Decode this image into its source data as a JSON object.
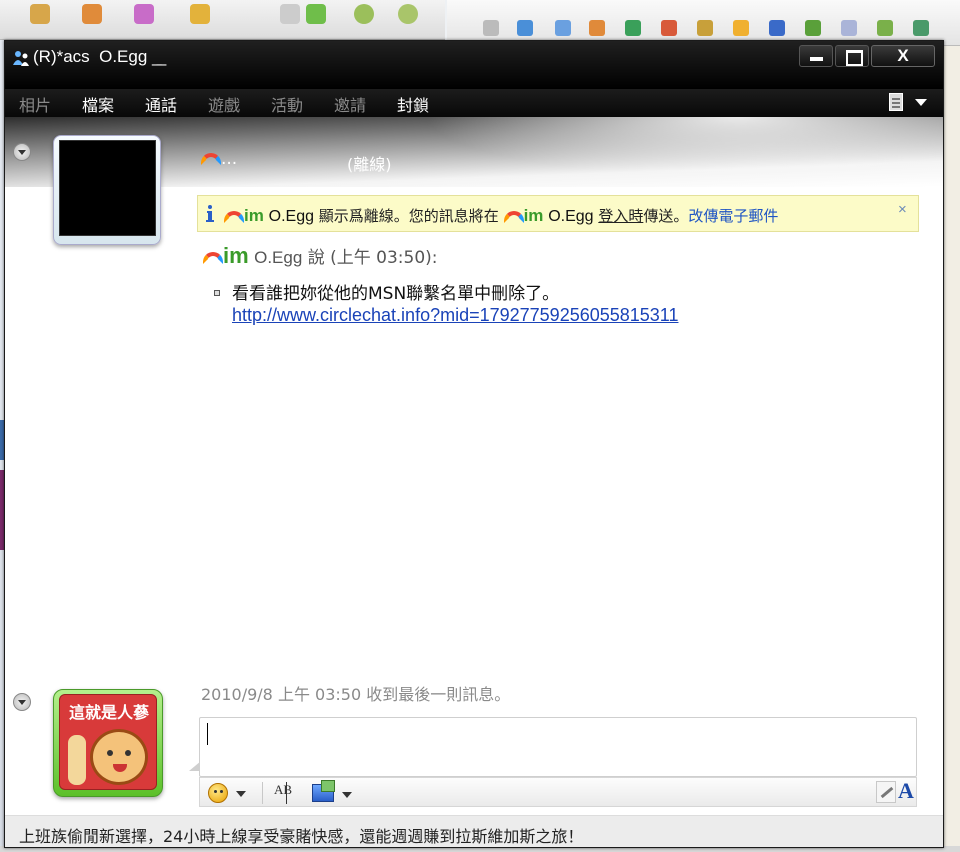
{
  "window": {
    "title": "(R)*acs  O.Egg  ̲ ̲"
  },
  "menu": {
    "items": [
      {
        "label": "相片",
        "enabled": false
      },
      {
        "label": "檔案",
        "enabled": true
      },
      {
        "label": "通話",
        "enabled": true
      },
      {
        "label": "遊戲",
        "enabled": false
      },
      {
        "label": "活動",
        "enabled": false
      },
      {
        "label": "邀請",
        "enabled": false
      },
      {
        "label": "封鎖",
        "enabled": true
      }
    ]
  },
  "contact": {
    "name": "...",
    "status": "(離線)"
  },
  "notice": {
    "nick": "O.Egg",
    "text_before": "顯示爲離線。您的訊息將在",
    "nick2": "O.Egg",
    "underline_text": "登入時",
    "text_after": "傳送。",
    "link": "改傳電子郵件",
    "close": "×",
    "im_logo": "im"
  },
  "message": {
    "im_logo": "im",
    "sender": "O.Egg",
    "says": "說 (上午 03:50):",
    "text": "看看誰把妳從他的MSN聯繫名單中刪除了。",
    "link": "http://www.circlechat.info?mid=17927759256055815311"
  },
  "footer": {
    "last_message": "2010/9/8 上午 03:50 收到最後一則訊息。",
    "my_picture_caption": "這就是人蔘",
    "font_button": "A",
    "voice_clip_label": "AB"
  },
  "ad": {
    "text": "上班族偷閒新選擇，24小時上線享受豪賭快感，還能週週賺到拉斯維加斯之旅！"
  },
  "colors": {
    "accent_link": "#1a43b8",
    "im_green": "#3a9b2a",
    "notice_bg": "#fcfbc8",
    "titlebar": "#000000"
  },
  "icons": {
    "title": "msn-buddy-icon",
    "notice": "info-icon",
    "emoticon": "smiley-icon",
    "wink": "wink-icon",
    "handwriting": "pen-icon",
    "font": "font-icon",
    "options": "options-icon"
  }
}
